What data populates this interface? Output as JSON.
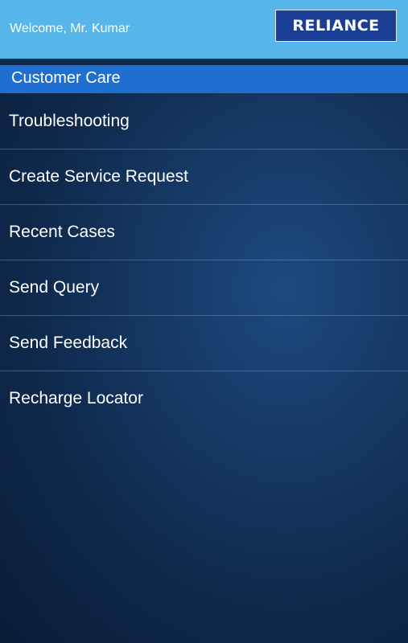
{
  "header": {
    "welcome": "Welcome, Mr. Kumar",
    "logo_text": "RELIANCE"
  },
  "section": {
    "title": "Customer Care"
  },
  "menu": {
    "items": [
      {
        "label": "Troubleshooting"
      },
      {
        "label": "Create Service Request"
      },
      {
        "label": "Recent Cases"
      },
      {
        "label": "Send Query"
      },
      {
        "label": "Send Feedback"
      },
      {
        "label": "Recharge Locator"
      }
    ]
  },
  "colors": {
    "header_bg": "#56b5e9",
    "section_bg": "#1f6fd0",
    "logo_bg": "#1b3f95",
    "background": "#0f2a4e"
  }
}
